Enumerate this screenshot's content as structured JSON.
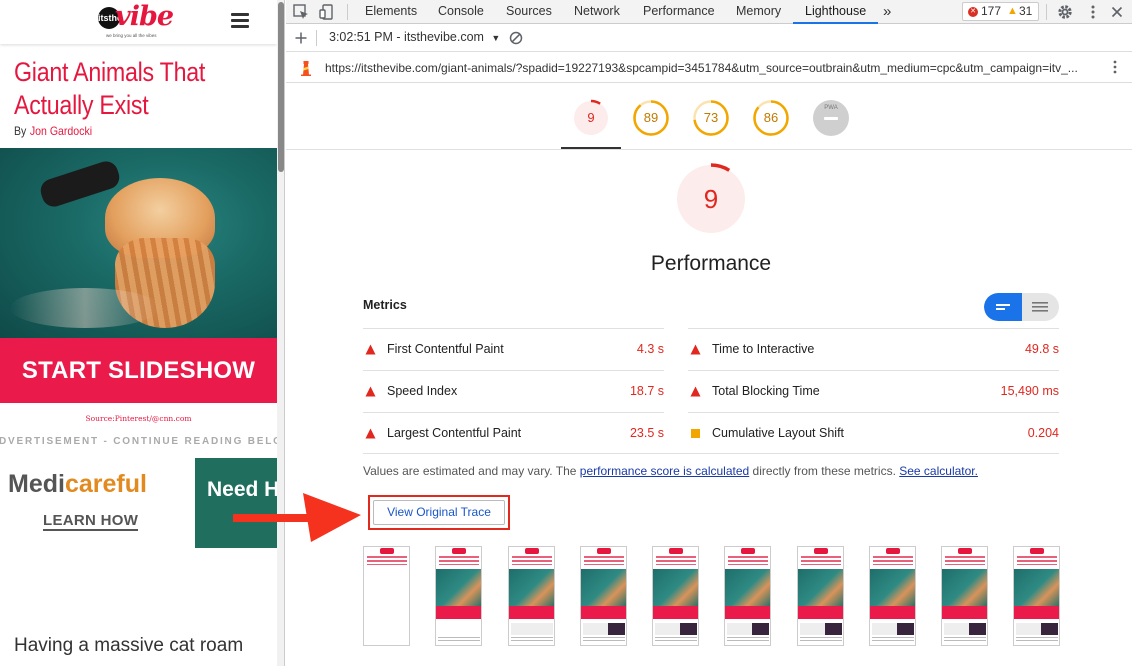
{
  "site": {
    "logo_text": "vibe",
    "logo_badge": "itsthe",
    "logo_tagline": "we bring you all the vibes",
    "title": "Giant Animals That Actually Exist",
    "byline_prefix": "By",
    "author": "Jon Gardocki",
    "slideshow_label": "START SLIDESHOW",
    "image_source": "Source:Pinterest/@cnn.com",
    "ad_label": "ADVERTISEMENT - CONTINUE READING BELOW",
    "ad1_brand_a": "Medi",
    "ad1_brand_b": "careful",
    "ad1_cta": "LEARN HOW",
    "ad2_text": "Need H",
    "teaser": "Having a massive cat roam"
  },
  "devtools": {
    "tabs": [
      "Elements",
      "Console",
      "Sources",
      "Network",
      "Performance",
      "Memory",
      "Lighthouse"
    ],
    "active_tab": "Lighthouse",
    "more_tabs": "»",
    "error_count": "177",
    "warning_count": "31",
    "report_time": "3:02:51 PM - itsthevibe.com",
    "report_url": "https://itsthevibe.com/giant-animals/?spadid=19227193&spcampid=3451784&utm_source=outbrain&utm_medium=cpc&utm_campaign=itv_...",
    "icons": {
      "inspect": "inspect-icon",
      "device": "device-toggle-icon",
      "settings": "gear-icon",
      "menu": "kebab-menu-icon",
      "close": "close-icon",
      "add": "plus-icon",
      "clear": "clear-icon",
      "lighthouse": "lighthouse-icon"
    }
  },
  "lighthouse": {
    "scores": [
      {
        "label": "9",
        "score": 9,
        "color": "#e0281f",
        "fill": "#fdecec"
      },
      {
        "label": "89",
        "score": 89,
        "color": "#f2a600",
        "fill": "#fff"
      },
      {
        "label": "73",
        "score": 73,
        "color": "#f2a600",
        "fill": "#fff"
      },
      {
        "label": "86",
        "score": 86,
        "color": "#f2a600",
        "fill": "#fff"
      },
      {
        "label": "PWA",
        "score": null,
        "color": "#9e9e9e",
        "fill": "#cfcfcf"
      }
    ],
    "big_score": "9",
    "category_title": "Performance",
    "metrics_header": "Metrics",
    "metrics_left": [
      {
        "name": "First Contentful Paint",
        "value": "4.3 s",
        "status": "fail"
      },
      {
        "name": "Speed Index",
        "value": "18.7 s",
        "status": "fail"
      },
      {
        "name": "Largest Contentful Paint",
        "value": "23.5 s",
        "status": "fail"
      }
    ],
    "metrics_right": [
      {
        "name": "Time to Interactive",
        "value": "49.8 s",
        "status": "fail"
      },
      {
        "name": "Total Blocking Time",
        "value": "15,490 ms",
        "status": "fail"
      },
      {
        "name": "Cumulative Layout Shift",
        "value": "0.204",
        "status": "average"
      }
    ],
    "disclaimer_a": "Values are estimated and may vary. The ",
    "disclaimer_link": "performance score is calculated",
    "disclaimer_b": " directly from these metrics. ",
    "disclaimer_link2": "See calculator.",
    "trace_button": "View Original Trace",
    "colors": {
      "fail": "#e0281f",
      "average": "#f2a600",
      "accent": "#1a73e8"
    }
  }
}
